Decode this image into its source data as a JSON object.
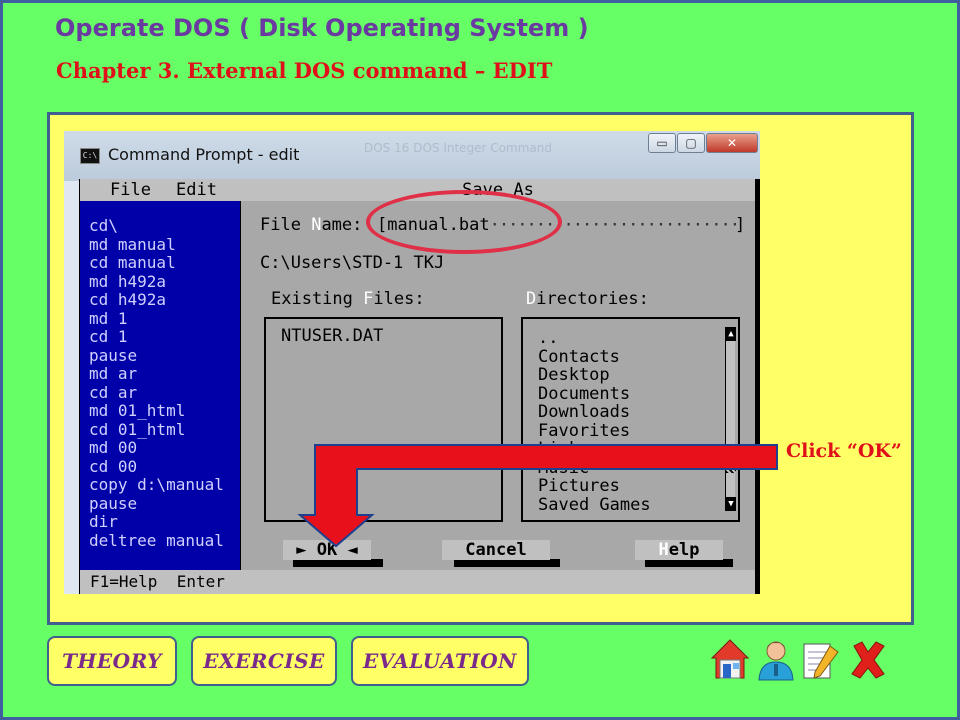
{
  "header": {
    "title": "Operate DOS ( Disk Operating System )",
    "chapter": "Chapter 3.   External DOS command – EDIT"
  },
  "window": {
    "icon_text": "C:\\",
    "title": "Command Prompt - edit",
    "background_title": "DOS 16 DOS Integer Command",
    "minimize": "▭",
    "maximize": "▢",
    "close": "✕"
  },
  "dos": {
    "menu": [
      "File",
      "Edit"
    ],
    "editor_lines": [
      "cd\\",
      "md manual",
      "cd manual",
      "md h492a",
      "cd h492a",
      "md 1",
      "cd 1",
      "pause",
      "md ar",
      "cd ar",
      "md 01_html",
      "cd 01_html",
      "md 00",
      "cd 00",
      "copy d:\\manual",
      "pause",
      "dir",
      "deltree manual"
    ],
    "status": "F1=Help  Enter"
  },
  "dialog": {
    "title": "Save As",
    "file_name_label_pre": "File ",
    "file_name_label_hot": "N",
    "file_name_label_post": "ame: ",
    "file_name_value": "[manual.bat",
    "file_name_end": "]",
    "current_dir": "C:\\Users\\STD-1 TKJ",
    "existing_files_pre": "Existing ",
    "existing_files_hot": "F",
    "existing_files_post": "iles:",
    "directories_hot": "D",
    "directories_post": "irectories:",
    "files": [
      "NTUSER.DAT"
    ],
    "directories": [
      "..",
      "Contacts",
      "Desktop",
      "Documents",
      "Downloads",
      "Favorites",
      "Links",
      "Music",
      "Pictures",
      "Saved Games"
    ],
    "ok_label": "OK",
    "cancel_label": "Cancel",
    "help_hot": "H",
    "help_post": "elp"
  },
  "annotation": {
    "callout": "Click “OK”"
  },
  "nav": {
    "theory": "THEORY",
    "exercise": "EXERCISE",
    "evaluation": "EVALUATION"
  },
  "icons": [
    "home-icon",
    "user-icon",
    "notepad-icon",
    "close-x-icon"
  ],
  "colors": {
    "background": "#66ff66",
    "panel": "#ffff66",
    "title": "#6b3aa0",
    "chapter": "#e0101a",
    "dos_blue": "#0000a8",
    "dos_gray": "#c0c0c0",
    "annotation_red": "#e8101a"
  }
}
